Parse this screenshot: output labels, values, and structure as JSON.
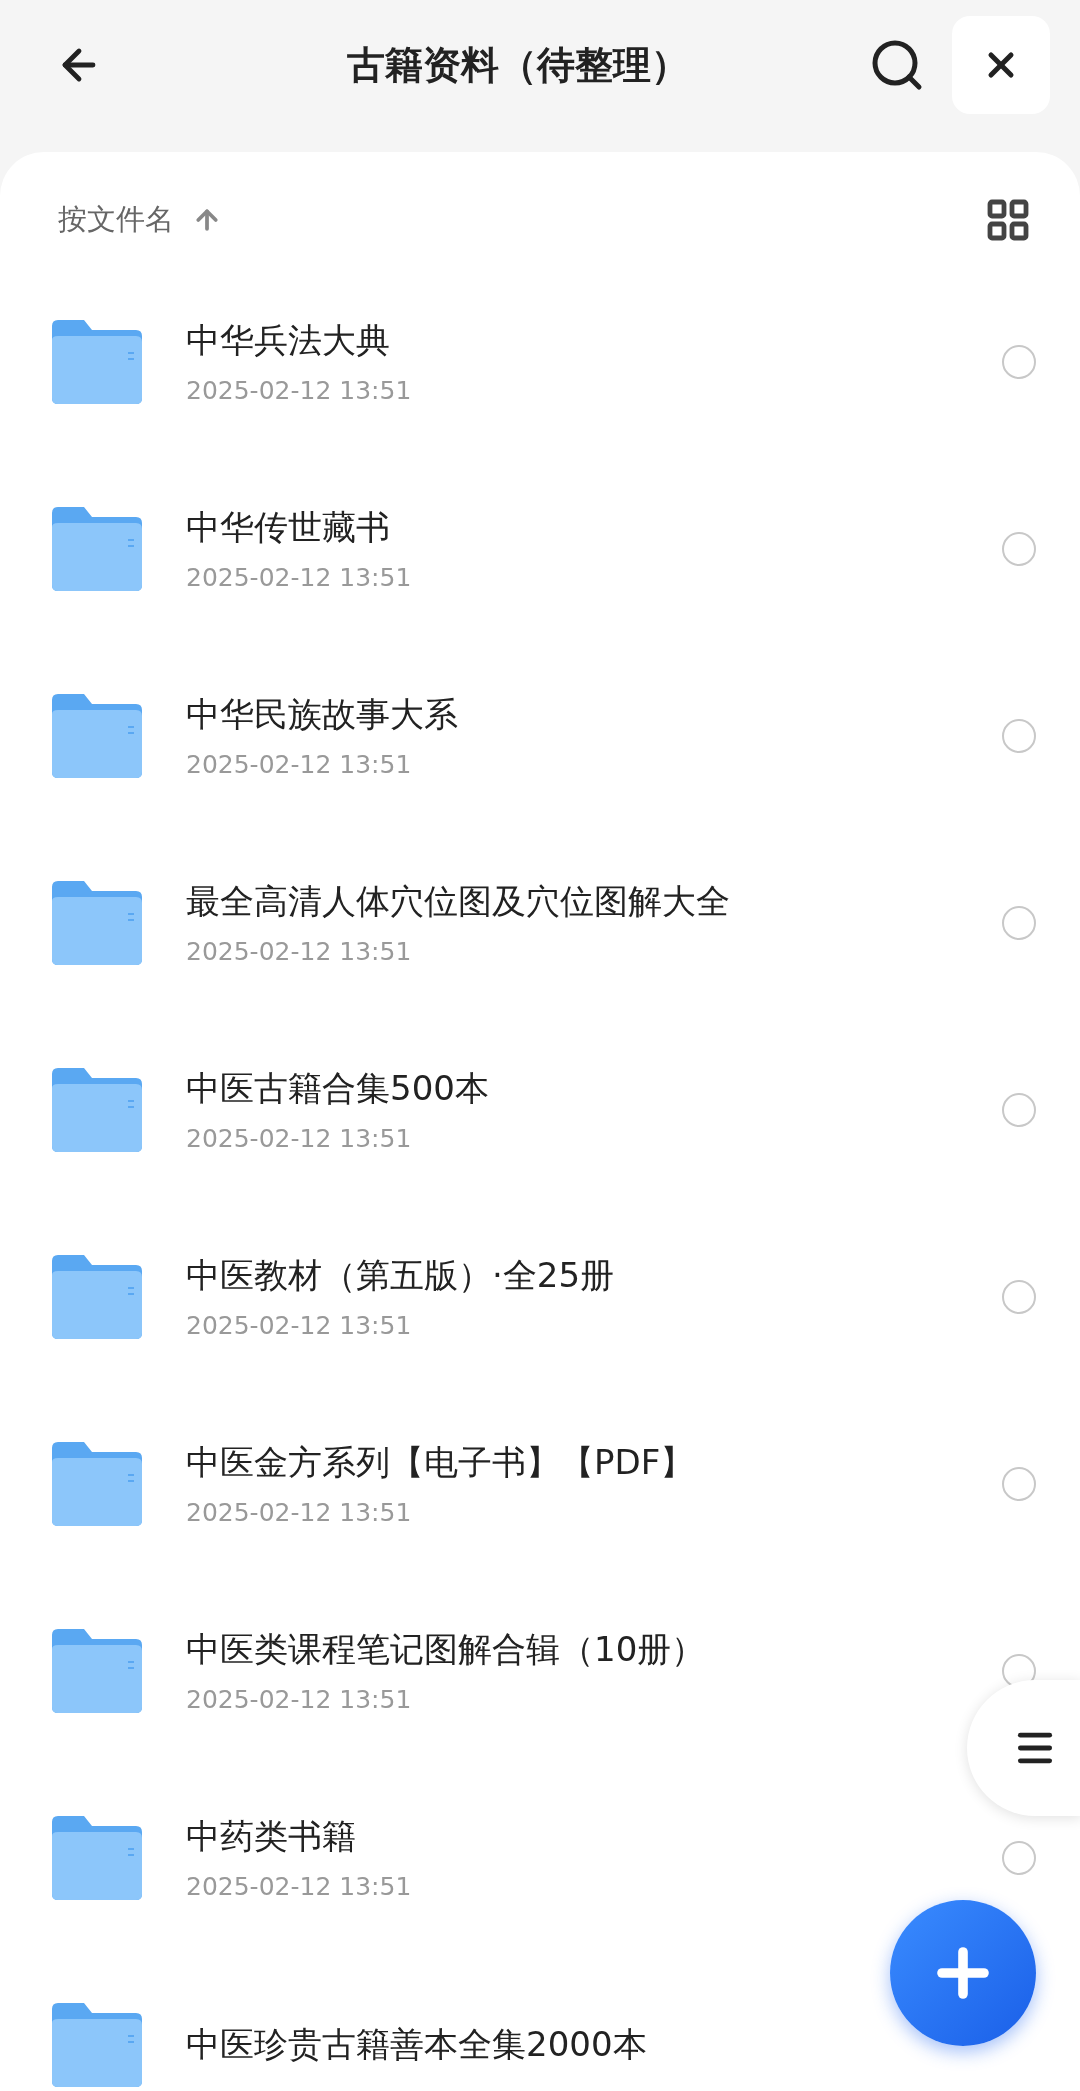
{
  "header": {
    "title": "古籍资料（待整理）"
  },
  "sort": {
    "label": "按文件名"
  },
  "files": [
    {
      "name": "中华兵法大典",
      "date": "2025-02-12 13:51",
      "selected": false
    },
    {
      "name": "中华传世藏书",
      "date": "2025-02-12 13:51",
      "selected": false
    },
    {
      "name": "中华民族故事大系",
      "date": "2025-02-12 13:51",
      "selected": false
    },
    {
      "name": "最全高清人体穴位图及穴位图解大全",
      "date": "2025-02-12 13:51",
      "selected": false
    },
    {
      "name": "中医古籍合集500本",
      "date": "2025-02-12 13:51",
      "selected": false
    },
    {
      "name": "中医教材（第五版）·全25册",
      "date": "2025-02-12 13:51",
      "selected": false
    },
    {
      "name": "中医金方系列【电子书】【PDF】",
      "date": "2025-02-12 13:51",
      "selected": false
    },
    {
      "name": "中医类课程笔记图解合辑（10册）",
      "date": "2025-02-12 13:51",
      "selected": false
    },
    {
      "name": "中药类书籍",
      "date": "2025-02-12 13:51",
      "selected": false
    },
    {
      "name": "中医珍贵古籍善本全集2000本"
    }
  ]
}
